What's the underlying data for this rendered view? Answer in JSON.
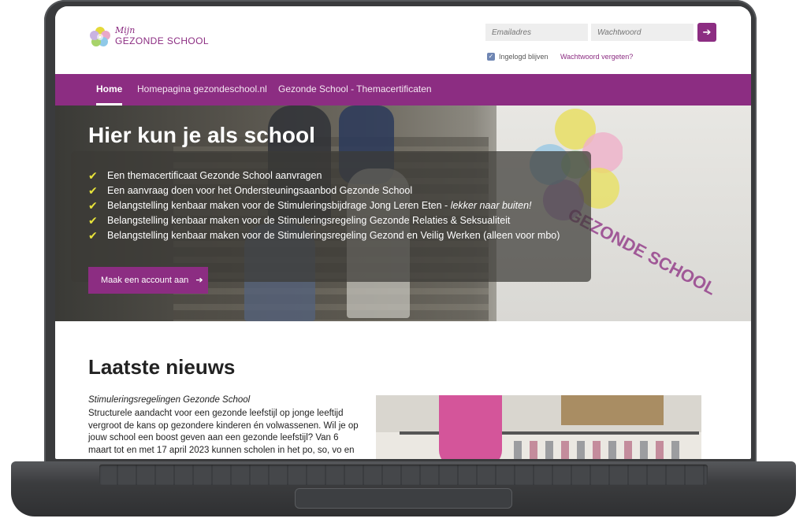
{
  "header": {
    "logo_small": "Mijn",
    "logo_name": "GEZONDE SCHOOL",
    "login": {
      "email_placeholder": "Emailadres",
      "password_placeholder": "Wachtwoord",
      "submit_icon": "arrow-right-icon",
      "remember_label": "Ingelogd blijven",
      "remember_checked": true,
      "forgot_label": "Wachtwoord vergeten?"
    }
  },
  "nav": {
    "items": [
      {
        "label": "Home",
        "active": true
      },
      {
        "label": "Homepagina gezondeschool.nl",
        "active": false
      },
      {
        "label": "Gezonde School - Themacertificaten",
        "active": false
      }
    ]
  },
  "hero": {
    "title": "Hier kun je als school",
    "list": [
      {
        "text": "Een themacertificaat Gezonde School aanvragen"
      },
      {
        "text": "Een aanvraag doen voor het Ondersteuningsaanbod Gezonde School"
      },
      {
        "text": "Belangstelling kenbaar maken voor de Stimuleringsbijdrage Jong Leren Eten - ",
        "emphasis": "lekker naar buiten!"
      },
      {
        "text": "Belangstelling kenbaar maken voor de Stimuleringsregeling Gezonde Relaties & Seksualiteit"
      },
      {
        "text": "Belangstelling kenbaar maken voor de Stimuleringsregeling Gezond en Veilig Werken (alleen voor mbo)"
      }
    ],
    "cta_label": "Maak een account aan",
    "banner_text": "GEZONDE SCHOOL"
  },
  "news": {
    "title": "Laatste nieuws",
    "item": {
      "title": "Stimuleringsregelingen Gezonde School",
      "text": "Structurele aandacht voor een gezonde leefstijl op jonge leeftijd vergroot de kans op gezondere kinderen én volwassenen. Wil je op jouw school een boost geven aan een gezonde leefstijl? Van 6 maart tot en met 17 april 2023 kunnen scholen in het po, so, vo en"
    }
  },
  "colors": {
    "brand": "#8c2d82",
    "check": "#e8e43a"
  }
}
